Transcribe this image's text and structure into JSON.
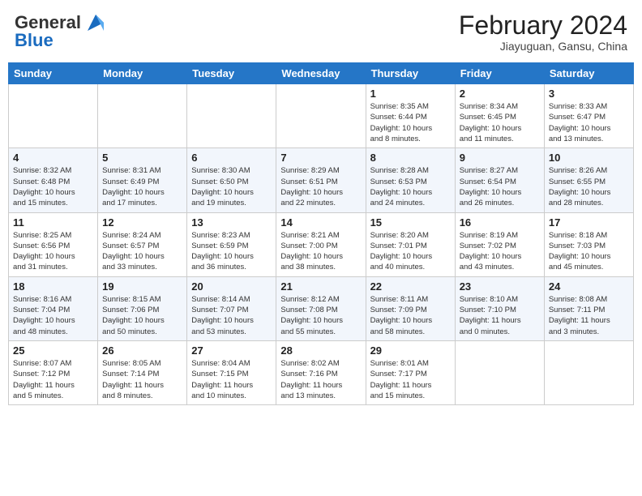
{
  "header": {
    "logo_general": "General",
    "logo_blue": "Blue",
    "month_title": "February 2024",
    "subtitle": "Jiayuguan, Gansu, China"
  },
  "weekdays": [
    "Sunday",
    "Monday",
    "Tuesday",
    "Wednesday",
    "Thursday",
    "Friday",
    "Saturday"
  ],
  "weeks": [
    [
      {
        "day": "",
        "info": ""
      },
      {
        "day": "",
        "info": ""
      },
      {
        "day": "",
        "info": ""
      },
      {
        "day": "",
        "info": ""
      },
      {
        "day": "1",
        "info": "Sunrise: 8:35 AM\nSunset: 6:44 PM\nDaylight: 10 hours\nand 8 minutes."
      },
      {
        "day": "2",
        "info": "Sunrise: 8:34 AM\nSunset: 6:45 PM\nDaylight: 10 hours\nand 11 minutes."
      },
      {
        "day": "3",
        "info": "Sunrise: 8:33 AM\nSunset: 6:47 PM\nDaylight: 10 hours\nand 13 minutes."
      }
    ],
    [
      {
        "day": "4",
        "info": "Sunrise: 8:32 AM\nSunset: 6:48 PM\nDaylight: 10 hours\nand 15 minutes."
      },
      {
        "day": "5",
        "info": "Sunrise: 8:31 AM\nSunset: 6:49 PM\nDaylight: 10 hours\nand 17 minutes."
      },
      {
        "day": "6",
        "info": "Sunrise: 8:30 AM\nSunset: 6:50 PM\nDaylight: 10 hours\nand 19 minutes."
      },
      {
        "day": "7",
        "info": "Sunrise: 8:29 AM\nSunset: 6:51 PM\nDaylight: 10 hours\nand 22 minutes."
      },
      {
        "day": "8",
        "info": "Sunrise: 8:28 AM\nSunset: 6:53 PM\nDaylight: 10 hours\nand 24 minutes."
      },
      {
        "day": "9",
        "info": "Sunrise: 8:27 AM\nSunset: 6:54 PM\nDaylight: 10 hours\nand 26 minutes."
      },
      {
        "day": "10",
        "info": "Sunrise: 8:26 AM\nSunset: 6:55 PM\nDaylight: 10 hours\nand 28 minutes."
      }
    ],
    [
      {
        "day": "11",
        "info": "Sunrise: 8:25 AM\nSunset: 6:56 PM\nDaylight: 10 hours\nand 31 minutes."
      },
      {
        "day": "12",
        "info": "Sunrise: 8:24 AM\nSunset: 6:57 PM\nDaylight: 10 hours\nand 33 minutes."
      },
      {
        "day": "13",
        "info": "Sunrise: 8:23 AM\nSunset: 6:59 PM\nDaylight: 10 hours\nand 36 minutes."
      },
      {
        "day": "14",
        "info": "Sunrise: 8:21 AM\nSunset: 7:00 PM\nDaylight: 10 hours\nand 38 minutes."
      },
      {
        "day": "15",
        "info": "Sunrise: 8:20 AM\nSunset: 7:01 PM\nDaylight: 10 hours\nand 40 minutes."
      },
      {
        "day": "16",
        "info": "Sunrise: 8:19 AM\nSunset: 7:02 PM\nDaylight: 10 hours\nand 43 minutes."
      },
      {
        "day": "17",
        "info": "Sunrise: 8:18 AM\nSunset: 7:03 PM\nDaylight: 10 hours\nand 45 minutes."
      }
    ],
    [
      {
        "day": "18",
        "info": "Sunrise: 8:16 AM\nSunset: 7:04 PM\nDaylight: 10 hours\nand 48 minutes."
      },
      {
        "day": "19",
        "info": "Sunrise: 8:15 AM\nSunset: 7:06 PM\nDaylight: 10 hours\nand 50 minutes."
      },
      {
        "day": "20",
        "info": "Sunrise: 8:14 AM\nSunset: 7:07 PM\nDaylight: 10 hours\nand 53 minutes."
      },
      {
        "day": "21",
        "info": "Sunrise: 8:12 AM\nSunset: 7:08 PM\nDaylight: 10 hours\nand 55 minutes."
      },
      {
        "day": "22",
        "info": "Sunrise: 8:11 AM\nSunset: 7:09 PM\nDaylight: 10 hours\nand 58 minutes."
      },
      {
        "day": "23",
        "info": "Sunrise: 8:10 AM\nSunset: 7:10 PM\nDaylight: 11 hours\nand 0 minutes."
      },
      {
        "day": "24",
        "info": "Sunrise: 8:08 AM\nSunset: 7:11 PM\nDaylight: 11 hours\nand 3 minutes."
      }
    ],
    [
      {
        "day": "25",
        "info": "Sunrise: 8:07 AM\nSunset: 7:12 PM\nDaylight: 11 hours\nand 5 minutes."
      },
      {
        "day": "26",
        "info": "Sunrise: 8:05 AM\nSunset: 7:14 PM\nDaylight: 11 hours\nand 8 minutes."
      },
      {
        "day": "27",
        "info": "Sunrise: 8:04 AM\nSunset: 7:15 PM\nDaylight: 11 hours\nand 10 minutes."
      },
      {
        "day": "28",
        "info": "Sunrise: 8:02 AM\nSunset: 7:16 PM\nDaylight: 11 hours\nand 13 minutes."
      },
      {
        "day": "29",
        "info": "Sunrise: 8:01 AM\nSunset: 7:17 PM\nDaylight: 11 hours\nand 15 minutes."
      },
      {
        "day": "",
        "info": ""
      },
      {
        "day": "",
        "info": ""
      }
    ]
  ]
}
